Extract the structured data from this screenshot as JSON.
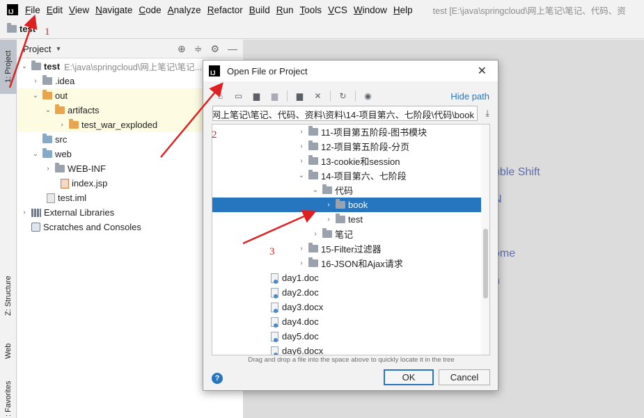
{
  "app": {
    "logo_text": "IJ",
    "menu": [
      "File",
      "Edit",
      "View",
      "Navigate",
      "Code",
      "Analyze",
      "Refactor",
      "Build",
      "Run",
      "Tools",
      "VCS",
      "Window",
      "Help"
    ],
    "window_title": "test [E:\\java\\springcloud\\网上笔记\\笔记、代码、资"
  },
  "navbar": {
    "project": "test"
  },
  "left_stripe": {
    "project_tab": "1: Project",
    "structure_tab": "Z: Structure",
    "web_tab": "Web",
    "favorites_tab": ": Favorites"
  },
  "project_panel": {
    "title": "Project",
    "tree": [
      {
        "label": "test",
        "extra": "E:\\java\\springcloud\\网上笔记\\笔记...",
        "bold": true
      },
      {
        "label": ".idea"
      },
      {
        "label": "out"
      },
      {
        "label": "artifacts"
      },
      {
        "label": "test_war_exploded"
      },
      {
        "label": "src"
      },
      {
        "label": "web"
      },
      {
        "label": "WEB-INF"
      },
      {
        "label": "index.jsp"
      },
      {
        "label": "test.iml"
      },
      {
        "label": "External Libraries"
      },
      {
        "label": "Scratches and Consoles"
      }
    ]
  },
  "editor_hints": [
    "uble Shift",
    "N",
    "ome",
    "n"
  ],
  "dialog": {
    "logo_text": "IJ",
    "title": "Open File or Project",
    "hide_path": "Hide path",
    "path": "\\网上笔记\\笔记、代码、资料\\资料\\14-项目第六、七阶段\\代码\\book",
    "tree": [
      {
        "label": "11-项目第五阶段-图书模块"
      },
      {
        "label": "12-项目第五阶段-分页"
      },
      {
        "label": "13-cookie和session"
      },
      {
        "label": "14-项目第六、七阶段"
      },
      {
        "label": "代码"
      },
      {
        "label": "book"
      },
      {
        "label": "test"
      },
      {
        "label": "笔记"
      },
      {
        "label": "15-Filter过滤器"
      },
      {
        "label": "16-JSON和Ajax请求"
      },
      {
        "label": "day1.doc"
      },
      {
        "label": "day2.doc"
      },
      {
        "label": "day3.docx"
      },
      {
        "label": "day4.doc"
      },
      {
        "label": "day5.doc"
      },
      {
        "label": "day6.docx"
      }
    ],
    "drag_hint": "Drag and drop a file into the space above to quickly locate it in the tree",
    "help": "?",
    "ok": "OK",
    "cancel": "Cancel"
  },
  "annotations": [
    "1",
    "2",
    "3"
  ],
  "colors": {
    "accent": "#2675bf",
    "annotation": "#e02020",
    "highlight_row": "#fdfbe2"
  }
}
